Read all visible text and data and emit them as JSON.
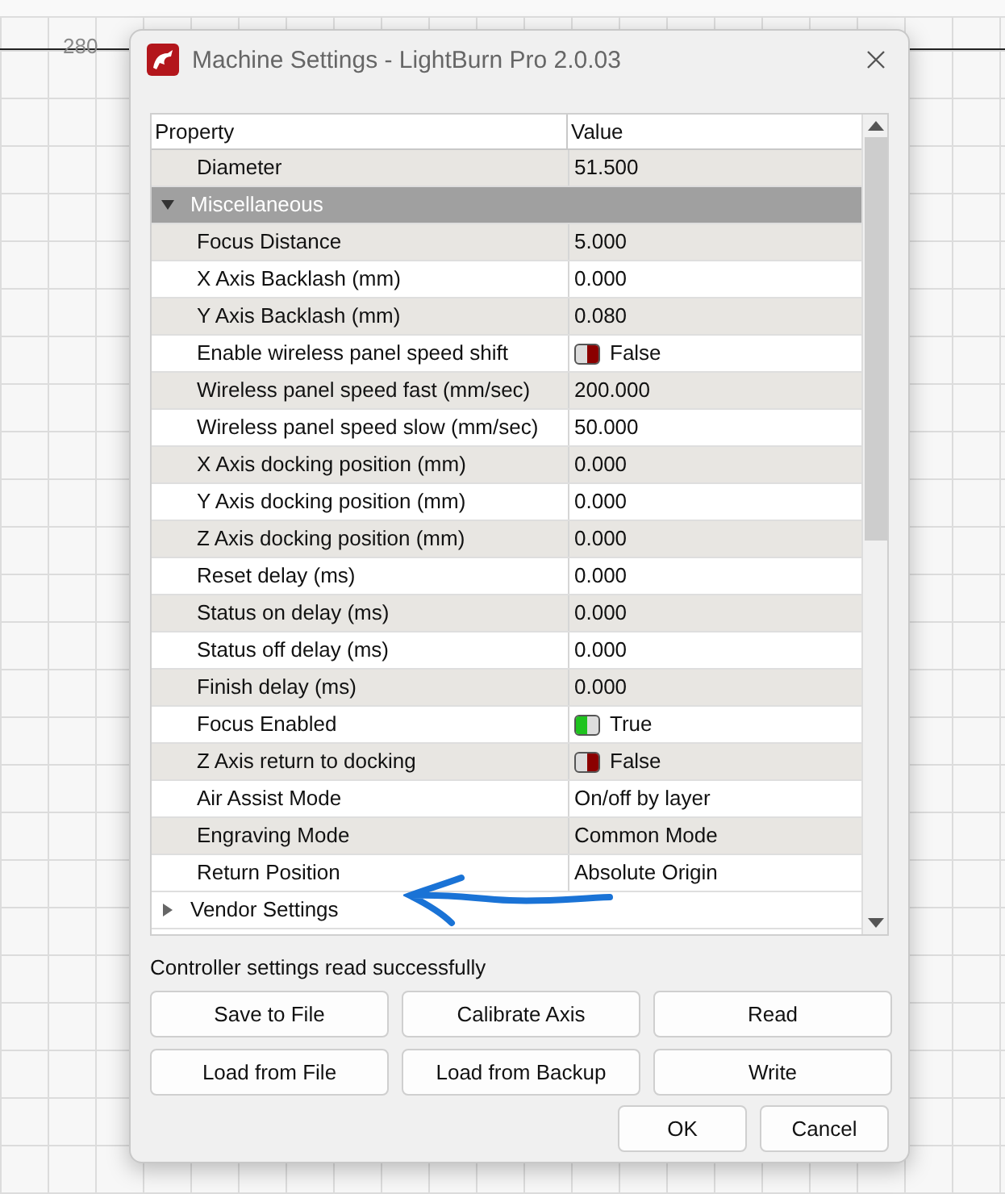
{
  "canvas": {
    "ruler_label": "280"
  },
  "window": {
    "title": "Machine Settings - LightBurn Pro 2.0.03"
  },
  "table": {
    "columns": [
      "Property",
      "Value"
    ],
    "rows": [
      {
        "kind": "property",
        "name": "Diameter",
        "value": "51.500"
      },
      {
        "kind": "category",
        "name": "Miscellaneous",
        "expanded": true
      },
      {
        "kind": "property",
        "name": "Focus Distance",
        "value": "5.000"
      },
      {
        "kind": "property",
        "name": "X Axis Backlash (mm)",
        "value": "0.000"
      },
      {
        "kind": "property",
        "name": "Y Axis Backlash (mm)",
        "value": "0.080"
      },
      {
        "kind": "toggle",
        "name": "Enable wireless panel speed shift",
        "value": "False",
        "on": false
      },
      {
        "kind": "property",
        "name": "Wireless panel speed fast (mm/sec)",
        "value": "200.000"
      },
      {
        "kind": "property",
        "name": "Wireless panel speed slow (mm/sec)",
        "value": "50.000"
      },
      {
        "kind": "property",
        "name": "X Axis docking position (mm)",
        "value": "0.000"
      },
      {
        "kind": "property",
        "name": "Y Axis docking position (mm)",
        "value": "0.000"
      },
      {
        "kind": "property",
        "name": "Z Axis docking position (mm)",
        "value": "0.000"
      },
      {
        "kind": "property",
        "name": "Reset delay (ms)",
        "value": "0.000"
      },
      {
        "kind": "property",
        "name": "Status on delay (ms)",
        "value": "0.000"
      },
      {
        "kind": "property",
        "name": "Status off delay (ms)",
        "value": "0.000"
      },
      {
        "kind": "property",
        "name": "Finish delay (ms)",
        "value": "0.000"
      },
      {
        "kind": "toggle",
        "name": "Focus Enabled",
        "value": "True",
        "on": true
      },
      {
        "kind": "toggle",
        "name": "Z Axis return to docking",
        "value": "False",
        "on": false
      },
      {
        "kind": "property",
        "name": "Air Assist Mode",
        "value": "On/off by layer"
      },
      {
        "kind": "property",
        "name": "Engraving Mode",
        "value": "Common Mode"
      },
      {
        "kind": "property",
        "name": "Return Position",
        "value": "Absolute Origin"
      },
      {
        "kind": "category",
        "name": "Vendor Settings",
        "expanded": false
      }
    ]
  },
  "status": "Controller settings read successfully",
  "buttons": [
    "Save to File",
    "Calibrate Axis",
    "Read",
    "Load from File",
    "Load from Backup",
    "Write"
  ],
  "dialog_buttons": [
    "OK",
    "Cancel"
  ]
}
